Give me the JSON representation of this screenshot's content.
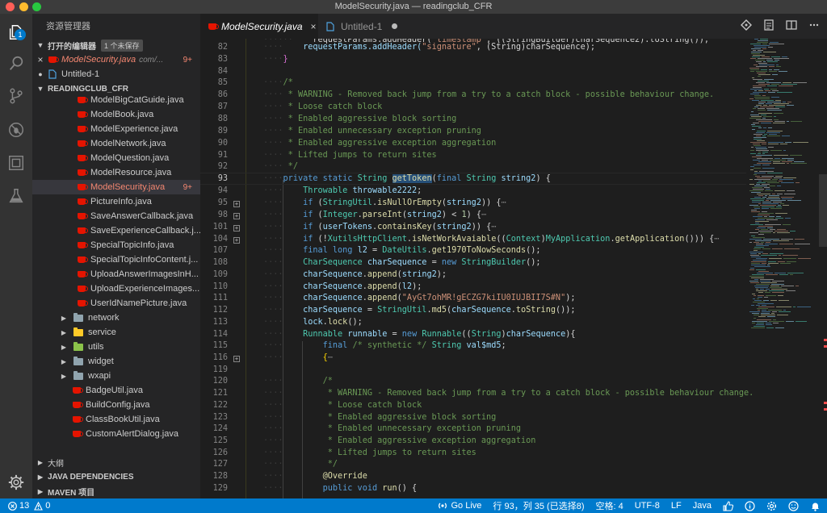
{
  "window": {
    "title": "ModelSecurity.java — readingclub_CFR"
  },
  "activity_bar": {
    "explorer_badge": "1"
  },
  "sidebar": {
    "title": "资源管理器",
    "open_editors": {
      "label": "打开的编辑器",
      "unsaved_badge": "1 个未保存",
      "items": [
        {
          "name": "ModelSecurity.java",
          "path": "com/...",
          "badge": "9+"
        },
        {
          "name": "Untitled-1"
        }
      ]
    },
    "project": {
      "label": "READINGCLUB_CFR",
      "files": [
        "ModelBigCatGuide.java",
        "ModelBook.java",
        "ModelExperience.java",
        "ModelNetwork.java",
        "ModelQuestion.java",
        "ModelResource.java",
        "ModelSecurity.java",
        "PictureInfo.java",
        "SaveAnswerCallback.java",
        "SaveExperienceCallback.j...",
        "SpecialTopicInfo.java",
        "SpecialTopicInfoContent.j...",
        "UploadAnswerImagesInH...",
        "UploadExperienceImages...",
        "UserIdNamePicture.java"
      ],
      "active_file_badge": "9+",
      "folders": [
        "network",
        "service",
        "utils",
        "widget",
        "wxapi"
      ],
      "root_files": [
        "BadgeUtil.java",
        "BuildConfig.java",
        "ClassBookUtil.java",
        "CustomAlertDialog.java"
      ]
    },
    "outline": "大纲",
    "java_dependencies": "JAVA DEPENDENCIES",
    "maven": "MAVEN 项目"
  },
  "tabs": [
    {
      "label": "ModelSecurity.java",
      "close": "×"
    },
    {
      "label": "Untitled-1"
    }
  ],
  "editor": {
    "line_numbers": [
      "82",
      "83",
      "84",
      "85",
      "86",
      "87",
      "88",
      "89",
      "90",
      "91",
      "92",
      "93",
      "94",
      "95",
      "98",
      "101",
      "104",
      "107",
      "108",
      "109",
      "110",
      "111",
      "112",
      "113",
      "114",
      "115",
      "116",
      "119",
      "120",
      "121",
      "122",
      "123",
      "124",
      "125",
      "126",
      "127",
      "128",
      "129"
    ],
    "current_line": "93",
    "fold_ellipsis": "⋯",
    "lines": {
      "l82_a": "requestParams.addHeader(",
      "l82_b": "\"signature\"",
      "l82_c": ", (String)charSequence);",
      "l83": "}",
      "l85": "/*",
      "l86": " * WARNING - Removed back jump from a try to a catch block - possible behaviour change.",
      "l87": " * Loose catch block",
      "l88": " * Enabled aggressive block sorting",
      "l89": " * Enabled unnecessary exception pruning",
      "l90": " * Enabled aggressive exception aggregation",
      "l91": " * Lifted jumps to return sites",
      "l92": " */",
      "l93_kw": "private static",
      "l93_ty": "String",
      "l93_fn": "getToken",
      "l93_rest_kw": "final",
      "l93_rest_ty": "String",
      "l93_var": "string2",
      "l94_ty": "Throwable",
      "l94_var": "throwable2222",
      "l95_kw": "if",
      "l95_ty": "StringUtil",
      "l95_fn": "isNullOrEmpty",
      "l95_var": "string2",
      "l98_kw": "if",
      "l98_ty": "Integer",
      "l98_fn": "parseInt",
      "l98_var": "string2",
      "l98_nm": "1",
      "l101_kw": "if",
      "l101_ty": "userTokens",
      "l101_fn": "containsKey",
      "l101_var": "string2",
      "l104_kw": "if",
      "l104_ty": "XutilsHttpClient",
      "l104_fn": "isNetWorkAvaiable",
      "l104_ty2": "Context",
      "l104_ty3": "MyApplication",
      "l104_fn2": "getApplication",
      "l107_kw": "final long",
      "l107_var": "l2",
      "l107_ty": "DateUtils",
      "l107_fn": "get1970ToNowSeconds",
      "l108_ty": "CharSequence",
      "l108_var": "charSequence",
      "l108_kw": "new",
      "l108_ty2": "StringBuilder",
      "l109_var": "charSequence",
      "l109_fn": "append",
      "l109_var2": "string2",
      "l110_var": "charSequence",
      "l110_fn": "append",
      "l110_var2": "l2",
      "l111_var": "charSequence",
      "l111_fn": "append",
      "l111_str": "\"AyGt7ohMR!gECZG7kiIU0IUJBII7S#N\"",
      "l112_var": "charSequence",
      "l112_ty": "StringUtil",
      "l112_fn": "md5",
      "l112_var2": "charSequence",
      "l112_fn2": "toString",
      "l113_var": "lock",
      "l113_fn": "lock",
      "l114_ty": "Runnable",
      "l114_var": "runnable",
      "l114_kw": "new",
      "l114_ty2": "Runnable",
      "l114_ty3": "String",
      "l114_var2": "charSequence",
      "l115_kw": "final",
      "l115_cm": "/* synthetic */",
      "l115_ty": "String",
      "l115_var": "val$md5",
      "l116": "{",
      "l120": "/*",
      "l121": " * WARNING - Removed back jump from a try to a catch block - possible behaviour change.",
      "l122": " * Loose catch block",
      "l123": " * Enabled aggressive block sorting",
      "l124": " * Enabled unnecessary exception pruning",
      "l125": " * Enabled aggressive exception aggregation",
      "l126": " * Lifted jumps to return sites",
      "l127": " */",
      "l128": "@Override",
      "l129_kw": "public void",
      "l129_fn": "run"
    }
  },
  "statusbar": {
    "errors": "13",
    "warnings": "0",
    "go_live": "Go Live",
    "position": "行 93，列 35 (已选择8)",
    "spaces": "空格: 4",
    "encoding": "UTF-8",
    "eol": "LF",
    "language": "Java"
  },
  "colors": {
    "accent": "#007acc",
    "error": "#f48771",
    "java_icon": "#e51400"
  }
}
